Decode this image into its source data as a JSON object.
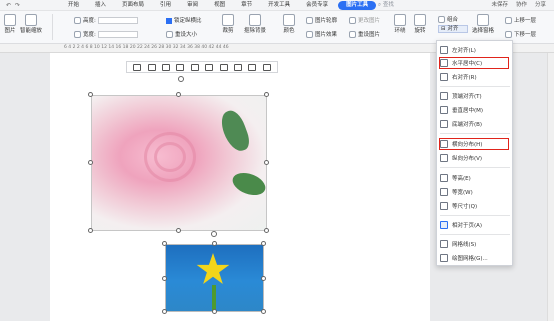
{
  "quick_access": {
    "undo": "↶",
    "redo": "↷"
  },
  "menu": {
    "tabs": [
      "开始",
      "插入",
      "页面布局",
      "引用",
      "审阅",
      "视图",
      "章节",
      "开发工具",
      "会员专享",
      "图片工具"
    ],
    "search": "查找",
    "right": [
      "未保存",
      "协作",
      "分享"
    ]
  },
  "ribbon": {
    "picture_label": "图片",
    "smart_crop_label": "智能缩放",
    "height_label": "高度:",
    "width_label": "宽度:",
    "height_value": "",
    "width_value": "",
    "lock_ratio_label": "锁定纵横比",
    "reset_size_label": "重设大小",
    "crop_label": "裁剪",
    "cutout_label": "抠除背景",
    "color_label": "颜色",
    "outline_label": "图片轮廓",
    "effect_label": "图片效果",
    "change_label": "更改图片",
    "reset_label": "重设图片",
    "wrap_label": "环绕",
    "rotate_label": "旋转",
    "group_label": "组合",
    "align_label": "对齐",
    "select_pane_label": "选择窗格",
    "up_label": "上移一层",
    "down_label": "下移一层"
  },
  "ruler": {
    "numbers": "6  4  2     2  4  6  8  10  12  14  16  18  20  22  24  26  28  30  32  34  36  38  40  42  44  46"
  },
  "align_menu": {
    "items": [
      {
        "label": "左对齐(L)",
        "icon": "align-left-icon"
      },
      {
        "label": "水平居中(C)",
        "icon": "align-center-icon",
        "highlighted": true
      },
      {
        "label": "右对齐(R)",
        "icon": "align-right-icon"
      },
      {
        "label": "顶端对齐(T)",
        "icon": "align-top-icon"
      },
      {
        "label": "垂直居中(M)",
        "icon": "align-middle-icon"
      },
      {
        "label": "底端对齐(B)",
        "icon": "align-bottom-icon"
      },
      {
        "label": "横向分布(H)",
        "icon": "distribute-horizontal-icon",
        "highlighted": true
      },
      {
        "label": "纵向分布(V)",
        "icon": "distribute-vertical-icon"
      },
      {
        "label": "等高(E)",
        "icon": "same-height-icon"
      },
      {
        "label": "等宽(W)",
        "icon": "same-width-icon"
      },
      {
        "label": "等尺寸(Q)",
        "icon": "same-size-icon"
      },
      {
        "label": "相对于页(A)",
        "icon": "relative-page-icon",
        "checked": true
      },
      {
        "label": "网格线(S)",
        "icon": "gridlines-icon"
      },
      {
        "label": "绘图网格(G)...",
        "icon": "drawing-grid-icon"
      }
    ]
  },
  "colors": {
    "accent": "#2b6ff3",
    "highlight_border": "#e0241b"
  }
}
